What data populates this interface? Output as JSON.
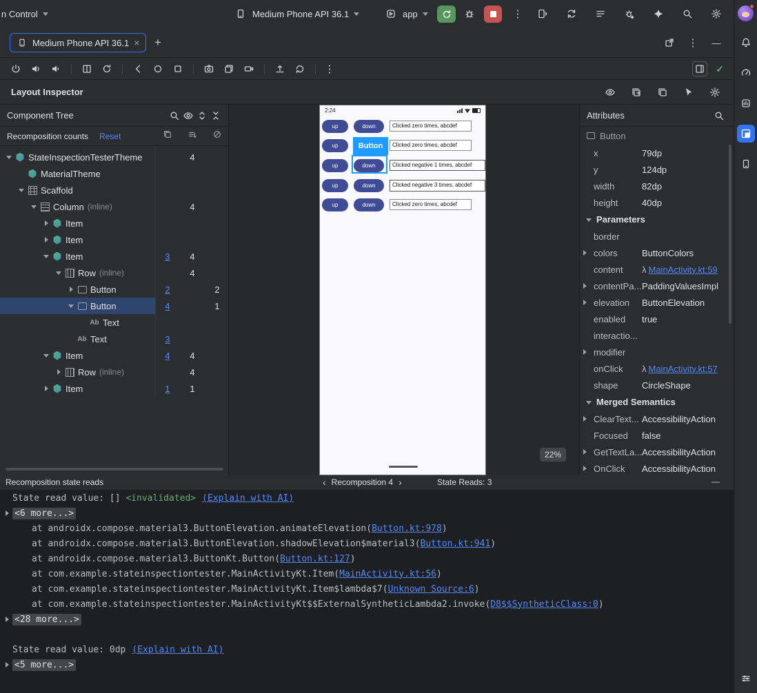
{
  "glyphs": {
    "kebab": "⋮",
    "check": "✓",
    "close": "×",
    "plus": "+",
    "minimize": "—",
    "chev_left": "‹",
    "chev_right": "›",
    "lambda": "λ",
    "ab": "Ab"
  },
  "topbar": {
    "vcs": "n Control",
    "device": "Medium Phone API 36.1",
    "run_config": "app"
  },
  "tabbar": {
    "tab": "Medium Phone API 36.1"
  },
  "inspector": {
    "title": "Layout Inspector"
  },
  "tree": {
    "title": "Component Tree",
    "counts_header": "Recomposition counts",
    "reset": "Reset",
    "rows": [
      {
        "label": "StateInspectionTesterTheme",
        "c2": "4"
      },
      {
        "label": "MaterialTheme"
      },
      {
        "label": "Scaffold"
      },
      {
        "label": "Column",
        "suffix": "(inline)",
        "c2": "4"
      },
      {
        "label": "Item"
      },
      {
        "label": "Item"
      },
      {
        "label": "Item",
        "c1": "3",
        "c2": "4"
      },
      {
        "label": "Row",
        "suffix": "(inline)",
        "c2": "4"
      },
      {
        "label": "Button",
        "c1": "2",
        "c3": "2"
      },
      {
        "label": "Button",
        "c1": "4",
        "c3": "1"
      },
      {
        "label": "Text"
      },
      {
        "label": "Text",
        "c1": "3"
      },
      {
        "label": "Item",
        "c1": "4",
        "c2": "4"
      },
      {
        "label": "Row",
        "suffix": "(inline)",
        "c2": "4"
      },
      {
        "label": "Item",
        "c1": "1",
        "c2": "1"
      }
    ]
  },
  "device": {
    "time": "2:24",
    "zoom_label": "22%",
    "selected_component_label": "Button",
    "up": "up",
    "down": "down",
    "fields": [
      "Clicked zero times, abcdef",
      "Clicked zero times, abcdef",
      "Clicked negative 1 times, abcdef",
      "Clicked negative 3 times, abcdef",
      "Clicked zero times, abcdef"
    ]
  },
  "attributes": {
    "title": "Attributes",
    "component": "Button",
    "geometry": [
      {
        "key": "x",
        "value": "79dp"
      },
      {
        "key": "y",
        "value": "124dp"
      },
      {
        "key": "width",
        "value": "82dp"
      },
      {
        "key": "height",
        "value": "40dp"
      }
    ],
    "parameters_label": "Parameters",
    "parameters": [
      {
        "key": "border",
        "value": ""
      },
      {
        "key": "colors",
        "value": "ButtonColors"
      },
      {
        "key": "content",
        "value": "MainActivity.kt:59"
      },
      {
        "key": "contentPa...",
        "value": "PaddingValuesImpl"
      },
      {
        "key": "elevation",
        "value": "ButtonElevation"
      },
      {
        "key": "enabled",
        "value": "true"
      },
      {
        "key": "interactio...",
        "value": ""
      },
      {
        "key": "modifier",
        "value": ""
      },
      {
        "key": "onClick",
        "value": "MainActivity.kt:57"
      },
      {
        "key": "shape",
        "value": "CircleShape"
      }
    ],
    "semantics_label": "Merged Semantics",
    "semantics": [
      {
        "key": "ClearText...",
        "value": "AccessibilityAction"
      },
      {
        "key": "Focused",
        "value": "false"
      },
      {
        "key": "GetTextLa...",
        "value": "AccessibilityAction"
      },
      {
        "key": "OnClick",
        "value": "AccessibilityAction"
      }
    ]
  },
  "console": {
    "title": "Recomposition state reads",
    "nav": "Recomposition 4",
    "reads": "State Reads: 3",
    "read1_prefix": "State read value: []",
    "read1_invalidated": "<invalidated>",
    "explain_link": "(Explain with AI)",
    "chips": [
      "<6 more...>",
      "<28 more...>",
      "<5 more...>"
    ],
    "traces": [
      {
        "text": "at androidx.compose.material3.ButtonElevation.animateElevation(",
        "link": "Button.kt:978",
        "close": ")"
      },
      {
        "text": "at androidx.compose.material3.ButtonElevation.shadowElevation$material3(",
        "link": "Button.kt:941",
        "close": ")"
      },
      {
        "text": "at androidx.compose.material3.ButtonKt.Button(",
        "link": "Button.kt:127",
        "close": ")"
      },
      {
        "text": "at com.example.stateinspectiontester.MainActivityKt.Item(",
        "link": "MainActivity.kt:56",
        "close": ")"
      },
      {
        "text": "at com.example.stateinspectiontester.MainActivityKt.Item$lambda$7(",
        "link": "Unknown Source:6",
        "close": ")"
      },
      {
        "text": "at com.example.stateinspectiontester.MainActivityKt$$ExternalSyntheticLambda2.invoke(",
        "link": "D8$$SyntheticClass:0",
        "close": ")"
      }
    ],
    "read2_prefix": "State read value: 0dp"
  }
}
